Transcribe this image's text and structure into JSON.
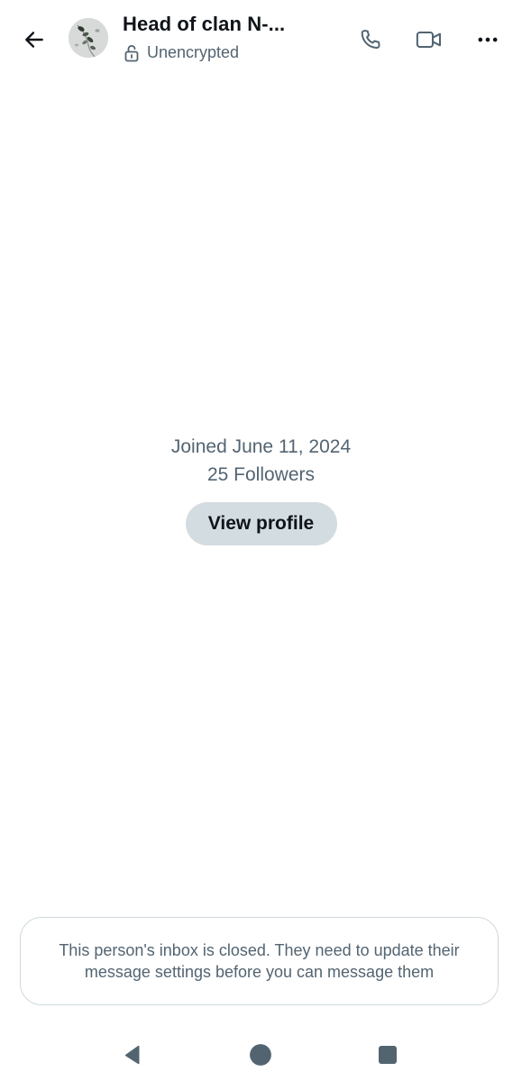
{
  "header": {
    "back_icon": "arrow-left-icon",
    "title": "Head of clan N-...",
    "encryption_icon": "unlocked-padlock-icon",
    "encryption_status": "Unencrypted",
    "actions": [
      {
        "icon": "phone-icon"
      },
      {
        "icon": "video-camera-icon"
      },
      {
        "icon": "more-horizontal-icon"
      }
    ]
  },
  "profile_info": {
    "joined": "Joined June 11, 2024",
    "followers": "25 Followers",
    "view_profile_label": "View profile"
  },
  "notice": {
    "text": "This person's inbox is closed. They need to update their message settings before you can message them"
  },
  "system_nav": {
    "back_icon": "triangle-back-icon",
    "home_icon": "circle-home-icon",
    "recents_icon": "square-recents-icon"
  },
  "colors": {
    "primary_text": "#0f1419",
    "secondary_text": "#536471",
    "button_bg": "#d3dce1",
    "border": "#cfd9de"
  }
}
